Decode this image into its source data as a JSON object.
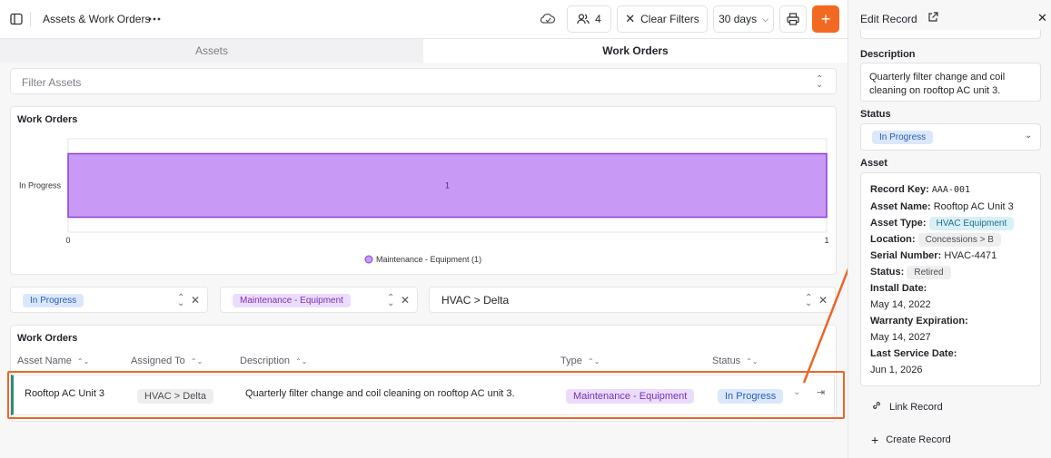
{
  "header": {
    "app_title": "Assets & Work Orders",
    "users_count": "4",
    "clear_filters": "Clear Filters",
    "date_range": "30 days"
  },
  "tabs": [
    {
      "label": "Assets",
      "active": false
    },
    {
      "label": "Work Orders",
      "active": true
    }
  ],
  "filter_assets": {
    "label": "Filter Assets"
  },
  "chart_data": {
    "type": "bar",
    "orientation": "horizontal",
    "title": "Work Orders",
    "categories": [
      "In Progress"
    ],
    "series": [
      {
        "name": "Maintenance - Equipment",
        "values": [
          1
        ],
        "color": "#c99af5"
      }
    ],
    "data_labels": [
      "1"
    ],
    "xlim": [
      0,
      1
    ],
    "x_ticks": [
      "0",
      "1"
    ],
    "legend": {
      "placement": "bottom-center",
      "entries": [
        "Maintenance - Equipment (1)"
      ]
    }
  },
  "filters": [
    {
      "value": "In Progress",
      "color": "blue"
    },
    {
      "value": "Maintenance - Equipment",
      "color": "purple"
    },
    {
      "value": "HVAC > Delta"
    }
  ],
  "table": {
    "title": "Work Orders",
    "columns": [
      "Asset Name",
      "Assigned To",
      "Description",
      "Type",
      "Status"
    ],
    "rows": [
      {
        "asset_name": "Rooftop AC Unit 3",
        "assigned_to": "HVAC > Delta",
        "description": "Quarterly filter change and coil cleaning on rooftop AC unit 3.",
        "type": "Maintenance - Equipment",
        "status": "In Progress"
      }
    ]
  },
  "panel": {
    "title": "Edit Record",
    "description_label": "Description",
    "description_value": "Quarterly filter change and coil cleaning on rooftop AC unit 3.",
    "status_label": "Status",
    "status_value": "In Progress",
    "asset_label": "Asset",
    "asset": {
      "record_key_label": "Record Key:",
      "record_key": "AAA-001",
      "asset_name_label": "Asset Name:",
      "asset_name": "Rooftop AC Unit 3",
      "asset_type_label": "Asset Type:",
      "asset_type": "HVAC Equipment",
      "location_label": "Location:",
      "location": "Concessions > B",
      "serial_label": "Serial Number:",
      "serial": "HVAC-4471",
      "status_label": "Status:",
      "status": "Retired",
      "install_label": "Install Date:",
      "install": "May 14, 2022",
      "warranty_label": "Warranty Expiration:",
      "warranty": "May 14, 2027",
      "last_service_label": "Last Service Date:",
      "last_service": "Jun 1, 2026"
    },
    "link_record": "Link Record",
    "create_record": "Create Record"
  },
  "colors": {
    "accent": "#f26a21",
    "highlight": "#e8672a",
    "bar_fill": "#c99af5",
    "bar_stroke": "#8a3fd6",
    "row_marker": "#2f8a7c"
  }
}
